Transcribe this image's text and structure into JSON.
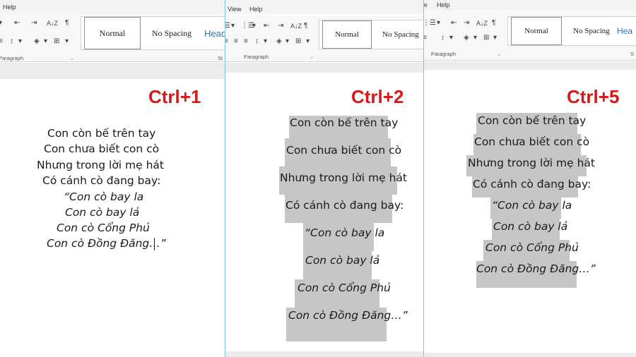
{
  "panels": [
    {
      "menu": [
        "Help"
      ],
      "group_label": "Paragraph",
      "styles": [
        "Normal",
        "No Spacing",
        "Head"
      ],
      "shortcut": "Ctrl+1",
      "poem": [
        "Con còn bế trên tay",
        "Con chưa biết con cò",
        "Nhưng trong lời mẹ hát",
        "Có cánh cò đang bay:",
        "“Con cò bay la",
        "Con cò bay lả",
        "Con cò Cổng Phủ",
        "Con cò Đồng Đăng…”"
      ],
      "partial_label": "St"
    },
    {
      "menu": [
        "View",
        "Help"
      ],
      "group_label": "Paragraph",
      "styles": [
        "Normal",
        "No Spacing"
      ],
      "shortcut": "Ctrl+2",
      "poem": [
        "Con còn bế trên tay",
        "Con chưa biết con cò",
        "Nhưng trong lời mẹ hát",
        "Có cánh cò đang bay:",
        "“Con cò bay la",
        "Con cò bay lả",
        "Con cò Cổng Phủ",
        "Con cò Đồng Đăng…”"
      ]
    },
    {
      "menu": [
        "w",
        "Help"
      ],
      "group_label": "Paragraph",
      "styles": [
        "Normal",
        "No Spacing",
        "Hea"
      ],
      "shortcut": "Ctrl+5",
      "poem": [
        "Con còn bế trên tay",
        "Con chưa biết con cò",
        "Nhưng trong lời mẹ hát",
        "Có cánh cò đang bay:",
        "“Con cò bay la",
        "Con cò bay lả",
        "Con cò Cổng Phủ",
        "Con cò Đồng Đăng…”"
      ],
      "partial_label": "S"
    }
  ],
  "icons": {
    "pilcrow": "¶",
    "sort": "A↓Z",
    "indent_decrease": "⇤",
    "indent_increase": "⇥",
    "line_spacing": "↕",
    "shading": "◈",
    "borders": "⊞",
    "bullets": "☰",
    "numbering": "⋮☰",
    "align": "≡",
    "dropdown": "▾",
    "launcher": "⌟"
  },
  "colors": {
    "shortcut": "#d51a18",
    "highlight": "#c6c6c6",
    "divider": "#7fc4dc",
    "heading_style": "#2e74b5"
  }
}
